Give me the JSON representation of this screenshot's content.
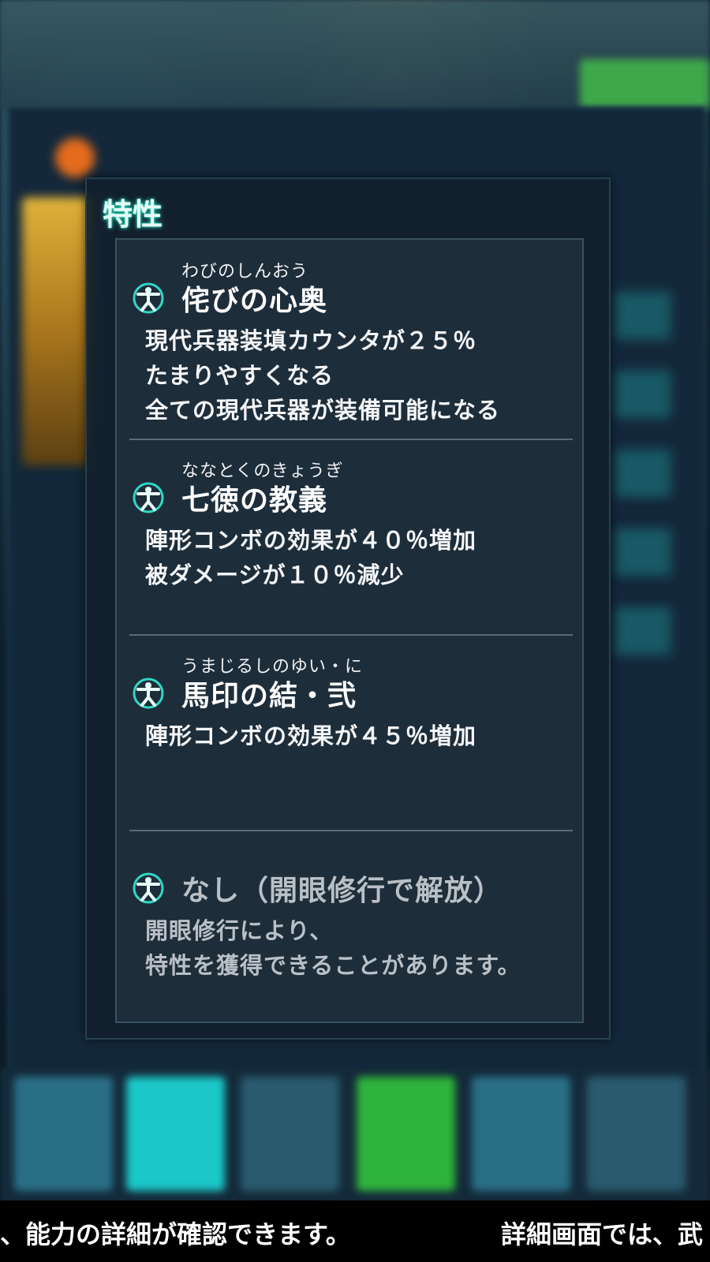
{
  "dialog": {
    "title": "特性",
    "traits": [
      {
        "ruby": "わびのしんおう",
        "name": "侘びの心奥",
        "desc": [
          "現代兵器装填カウンタが２５％",
          "たまりやすくなる",
          "全ての現代兵器が装備可能になる"
        ],
        "icon": "vitruvian-person-icon",
        "locked": false
      },
      {
        "ruby": "ななとくのきょうぎ",
        "name": "七徳の教義",
        "desc": [
          "陣形コンボの効果が４０％増加",
          "被ダメージが１０％減少"
        ],
        "icon": "vitruvian-person-icon",
        "locked": false
      },
      {
        "ruby": "うまじるしのゆい・に",
        "name": "馬印の結・弐",
        "desc": [
          "陣形コンボの効果が４５％増加"
        ],
        "icon": "vitruvian-person-icon",
        "locked": false
      },
      {
        "ruby": "",
        "name": "なし（開眼修行で解放）",
        "desc": [
          "開眼修行により、",
          "特性を獲得できることがあります。"
        ],
        "icon": "vitruvian-person-icon",
        "locked": true
      }
    ]
  },
  "ticker": {
    "left_text": "、能力の詳細が確認できます。",
    "right_text": "詳細画面では、武"
  },
  "colors": {
    "title_glow": "#2be7c7",
    "icon_color": "#2fd8c4",
    "bottom_tiles": [
      "#2a6f86",
      "#1bc7c7",
      "#2a5a6e",
      "#2eb33c",
      "#2a6f86",
      "#2a5a6e"
    ]
  }
}
